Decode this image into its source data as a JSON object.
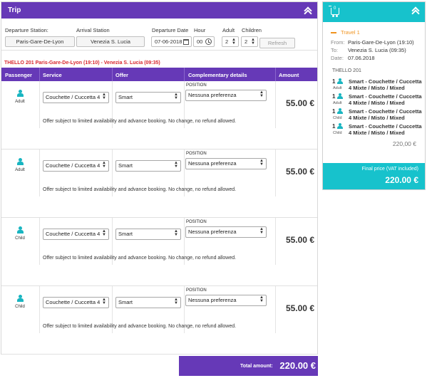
{
  "trip": {
    "title": "Trip"
  },
  "search": {
    "departure_label": "Departure Station:",
    "departure_value": "Paris-Gare-De-Lyon",
    "arrival_label": "Arrival Station",
    "arrival_value": "Venezia S. Lucia",
    "date_label": "Departure Date",
    "date_value": "07-06-2018",
    "hour_label": "Hour",
    "hour_value": "00",
    "adult_label": "Adult",
    "adult_value": "2",
    "children_label": "Children",
    "children_value": "2",
    "refresh_label": "Refresh"
  },
  "route": "THELLO 201  Paris-Gare-De-Lyon (19:10) - Venezia S. Lucia (09:35)",
  "table": {
    "headers": [
      "Passenger",
      "Service",
      "Offer",
      "Complementary details",
      "Amount"
    ],
    "rows": [
      {
        "passenger": "Adult",
        "service": "Couchette / Cuccetta 4",
        "offer": "Smart",
        "position_label": "POSITION",
        "position": "Nessuna preferenza",
        "amount": "55.00 €",
        "notice": "Offer subject to limited availability and advance booking. No change, no refund allowed."
      },
      {
        "passenger": "Adult",
        "service": "Couchette / Cuccetta 4",
        "offer": "Smart",
        "position_label": "POSITION",
        "position": "Nessuna preferenza",
        "amount": "55.00 €",
        "notice": "Offer subject to limited availability and advance booking. No change, no refund allowed."
      },
      {
        "passenger": "Child",
        "service": "Couchette / Cuccetta 4",
        "offer": "Smart",
        "position_label": "POSITION",
        "position": "Nessuna preferenza",
        "amount": "55.00 €",
        "notice": "Offer subject to limited availability and advance booking. No change, no refund allowed."
      },
      {
        "passenger": "Child",
        "service": "Couchette / Cuccetta 4",
        "offer": "Smart",
        "position_label": "POSITION",
        "position": "Nessuna preferenza",
        "amount": "55.00 €",
        "notice": "Offer subject to limited availability and advance booking. No change, no refund allowed."
      }
    ]
  },
  "total": {
    "label": "Total amount:",
    "value": "220.00 €"
  },
  "cart": {
    "badge": "0",
    "travel_title": "Travel 1",
    "from_label": "From:",
    "from_value": "Paris-Gare-De-Lyon (19:10)",
    "to_label": "To:",
    "to_value": "Venezia S. Lucia (09:35)",
    "date_label": "Date:",
    "date_value": "07.06.2018",
    "train": "THELLO  201",
    "items": [
      {
        "qty": "1",
        "ptype": "Adult",
        "line1": "Smart  -  Couchette / Cuccetta",
        "line2": "4 Mixte / Misto / Mixed"
      },
      {
        "qty": "1",
        "ptype": "Adult",
        "line1": "Smart  -  Couchette / Cuccetta",
        "line2": "4 Mixte / Misto / Mixed"
      },
      {
        "qty": "1",
        "ptype": "Child",
        "line1": "Smart  -  Couchette / Cuccetta",
        "line2": "4 Mixte / Misto / Mixed"
      },
      {
        "qty": "1",
        "ptype": "Child",
        "line1": "Smart  -  Couchette / Cuccetta",
        "line2": "4 Mixte / Misto / Mixed"
      }
    ],
    "subtotal": "220,00 €",
    "final_label": "Final price (VAT included)",
    "final_value": "220.00 €"
  },
  "colors": {
    "primary": "#6639b7",
    "accent": "#17c2cc",
    "route": "#d9282f",
    "travel": "#f0931e"
  }
}
